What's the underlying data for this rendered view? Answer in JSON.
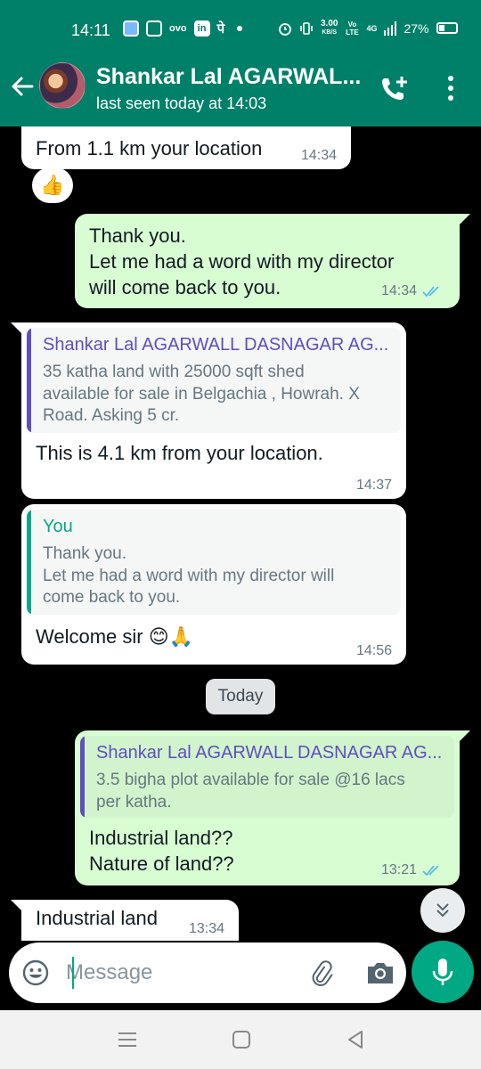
{
  "status_bar": {
    "time": "14:11",
    "carrier_icon_text": "ovo",
    "app_text": "in",
    "hindi_char": "पे",
    "speed_value": "3.00",
    "speed_unit": "KB/S",
    "volte": "Vo LTE",
    "network": "4G",
    "battery": "27%"
  },
  "header": {
    "contact_name": "Shankar Lal AGARWAL...",
    "last_seen": "last seen today at 14:03"
  },
  "messages": {
    "m1": {
      "text": "From 1.1 km your location",
      "time": "14:34",
      "reaction": "👍"
    },
    "m2": {
      "text": "Thank you.\nLet me had a word with my director\nwill come back to you.",
      "time": "14:34"
    },
    "m3": {
      "quote_author": "Shankar Lal AGARWALL DASNAGAR AG...",
      "quote_text": "35 katha land with 25000 sqft shed\navailable for sale in Belgachia , Howrah. X\nRoad. Asking 5 cr.",
      "text": "This is 4.1 km from your location.",
      "time": "14:37"
    },
    "m4": {
      "quote_author": "You",
      "quote_text": "Thank you.\nLet me had a word with my director will\ncome back to you.",
      "text": "Welcome sir 😊🙏",
      "time": "14:56"
    },
    "date_chip": "Today",
    "m5": {
      "quote_author": "Shankar Lal AGARWALL DASNAGAR AG...",
      "quote_text": "3.5 bigha plot available for sale @16 lacs\nper katha.",
      "text": "Industrial land??\nNature of land??",
      "time": "13:21"
    },
    "m6": {
      "text": "Industrial land",
      "time": "13:34"
    }
  },
  "composer": {
    "placeholder": "Message"
  },
  "colors": {
    "header": "#008069",
    "outgoing_bubble": "#d9fdd3",
    "incoming_bubble": "#ffffff",
    "quote_author_contact": "#5e4fbf",
    "quote_author_you": "#06a88a",
    "read_ticks": "#53bdeb",
    "mic_button": "#00a884"
  },
  "icons": {
    "back": "arrow-left-icon",
    "call_add": "phone-plus-icon",
    "menu": "more-vertical-icon",
    "emoji": "smiley-icon",
    "attach": "paperclip-icon",
    "camera": "camera-icon",
    "mic": "microphone-icon",
    "scroll_down": "double-chevron-down-icon"
  }
}
